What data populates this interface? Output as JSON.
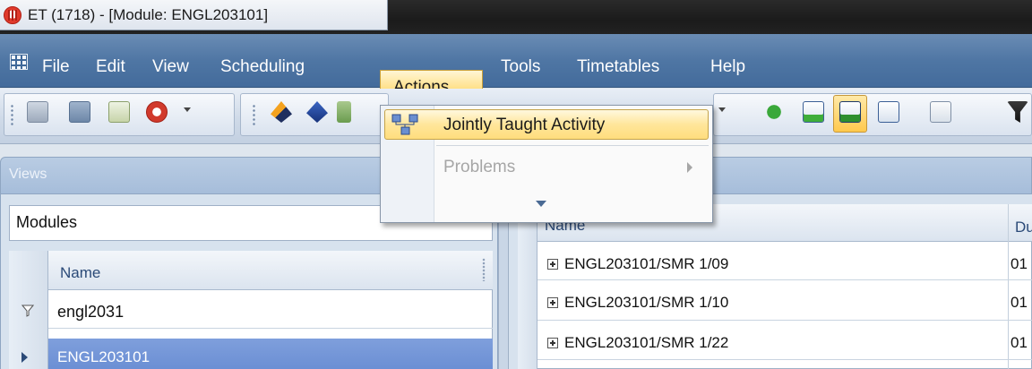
{
  "window": {
    "title": "ET (1718) - [Module: ENGL203101]"
  },
  "menubar": {
    "items": [
      {
        "label": "File"
      },
      {
        "label": "Edit"
      },
      {
        "label": "View"
      },
      {
        "label": "Scheduling"
      },
      {
        "label": "Actions"
      },
      {
        "label": "Tools"
      },
      {
        "label": "Timetables"
      },
      {
        "label": "Help"
      }
    ]
  },
  "actions_menu": {
    "items": [
      {
        "label": "Jointly Taught Activity",
        "state": "highlighted"
      },
      {
        "label": "Problems",
        "state": "disabled",
        "has_submenu": true
      }
    ],
    "overflow_indicator": "chevron-down-icon"
  },
  "views_panel": {
    "title": "Views",
    "selector_value": "Modules",
    "grid": {
      "column_header": "Name",
      "filter_value": "engl2031",
      "rows": [
        "ENGL203101"
      ]
    }
  },
  "module_grid": {
    "columns": [
      "Name",
      "Du"
    ],
    "rows": [
      {
        "name": "ENGL203101/SMR 1/09",
        "du": "01"
      },
      {
        "name": "ENGL203101/SMR 1/10",
        "du": "01"
      },
      {
        "name": "ENGL203101/SMR 1/22",
        "du": "01"
      }
    ]
  },
  "colors": {
    "menubar": "#4f76a4",
    "highlight": "#ffe18a",
    "selected_row": "#7395d6"
  }
}
